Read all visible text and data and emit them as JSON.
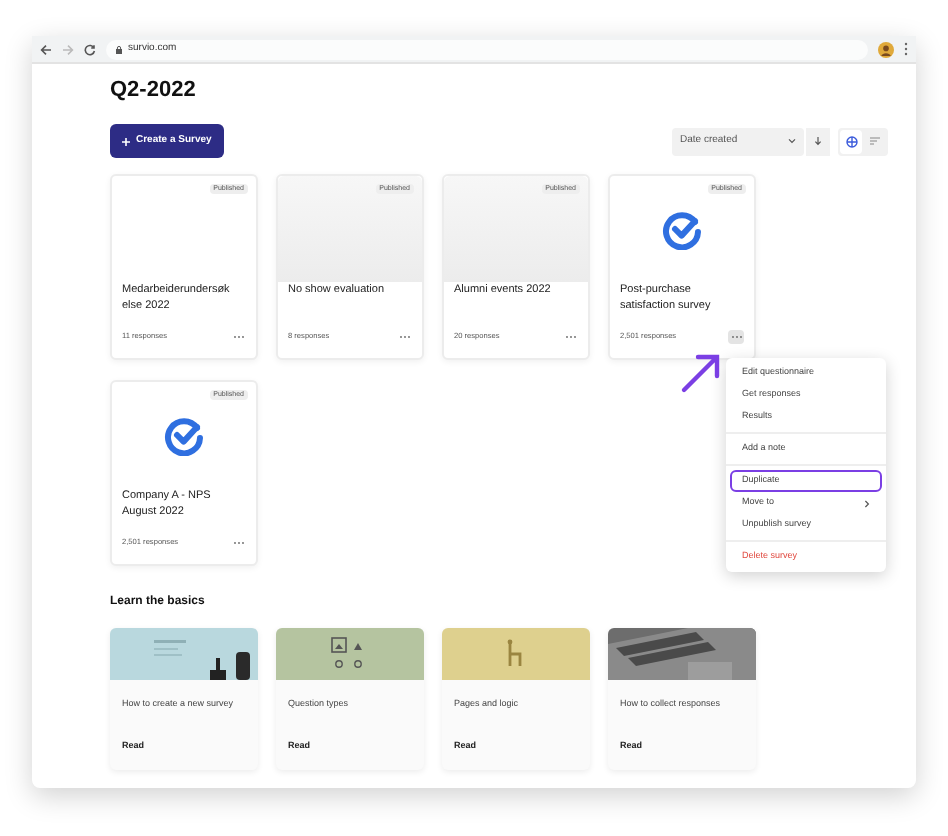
{
  "browser": {
    "url": "survio.com"
  },
  "page": {
    "title": "Q2-2022",
    "create_button": "Create a Survey",
    "sort": {
      "value": "Date created"
    },
    "view": [
      {
        "kind": "grid",
        "selected": true
      },
      {
        "kind": "list",
        "selected": false
      }
    ]
  },
  "surveys": [
    {
      "kind": "blank",
      "status": "Published",
      "title": "Medarbeiderundersøkelse 2022",
      "responses": "11 responses"
    },
    {
      "kind": "placeholder",
      "status": "Published",
      "title": "No show evaluation",
      "responses": "8 responses"
    },
    {
      "kind": "placeholder",
      "status": "Published",
      "title": "Alumni events 2022",
      "responses": "20 responses"
    },
    {
      "kind": "check",
      "status": "Published",
      "title": "Post-purchase satisfaction survey",
      "responses": "2,501 responses",
      "menu_open": true
    },
    {
      "kind": "check",
      "status": "Published",
      "title": "Company A - NPS August 2022",
      "responses": "2,501 responses",
      "menu_open": false
    }
  ],
  "context_menu": {
    "groups": [
      [
        {
          "kind": "item",
          "label": "Edit questionnaire",
          "selected": false
        },
        {
          "kind": "item",
          "label": "Get responses",
          "selected": false
        },
        {
          "kind": "item",
          "label": "Results",
          "selected": false
        }
      ],
      [
        {
          "kind": "item",
          "label": "Add a note",
          "selected": false
        }
      ],
      [
        {
          "kind": "item",
          "label": "Duplicate",
          "selected": true
        },
        {
          "kind": "submenu",
          "label": "Move to",
          "selected": false
        },
        {
          "kind": "item",
          "label": "Unpublish survey",
          "selected": false
        }
      ],
      [
        {
          "kind": "danger",
          "label": "Delete survey",
          "selected": false
        }
      ]
    ]
  },
  "learn": {
    "title": "Learn the basics",
    "cards": [
      {
        "kind": "picture",
        "title": "How to create a new survey",
        "link": "Read"
      },
      {
        "kind": "picture",
        "title": "Question types",
        "link": "Read"
      },
      {
        "kind": "picture",
        "title": "Pages and logic",
        "link": "Read"
      },
      {
        "kind": "picture",
        "title": "How to collect responses",
        "link": "Read"
      }
    ]
  }
}
